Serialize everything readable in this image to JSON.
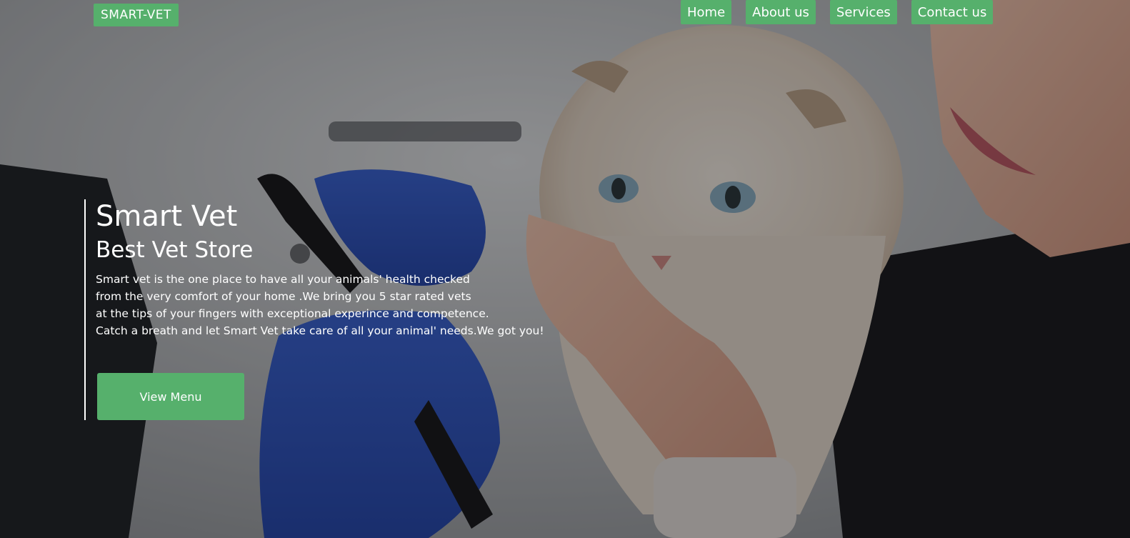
{
  "brand": {
    "logo_text": "SMART-VET",
    "accent_color": "#56b06c"
  },
  "nav": {
    "items": [
      {
        "label": "Home"
      },
      {
        "label": "About us"
      },
      {
        "label": "Services"
      },
      {
        "label": "Contact us"
      }
    ]
  },
  "hero": {
    "title": "Smart Vet",
    "subtitle": "Best Vet Store",
    "description_lines": [
      "Smart vet is the one place to have all your animals' health checked",
      "from the very comfort of your home .We bring you 5 star rated vets",
      "at the tips of your fingers with exceptional experince and competence.",
      "Catch a breath and let Smart Vet take care of all your animal' needs.We got you!"
    ],
    "cta_label": "View Menu"
  }
}
